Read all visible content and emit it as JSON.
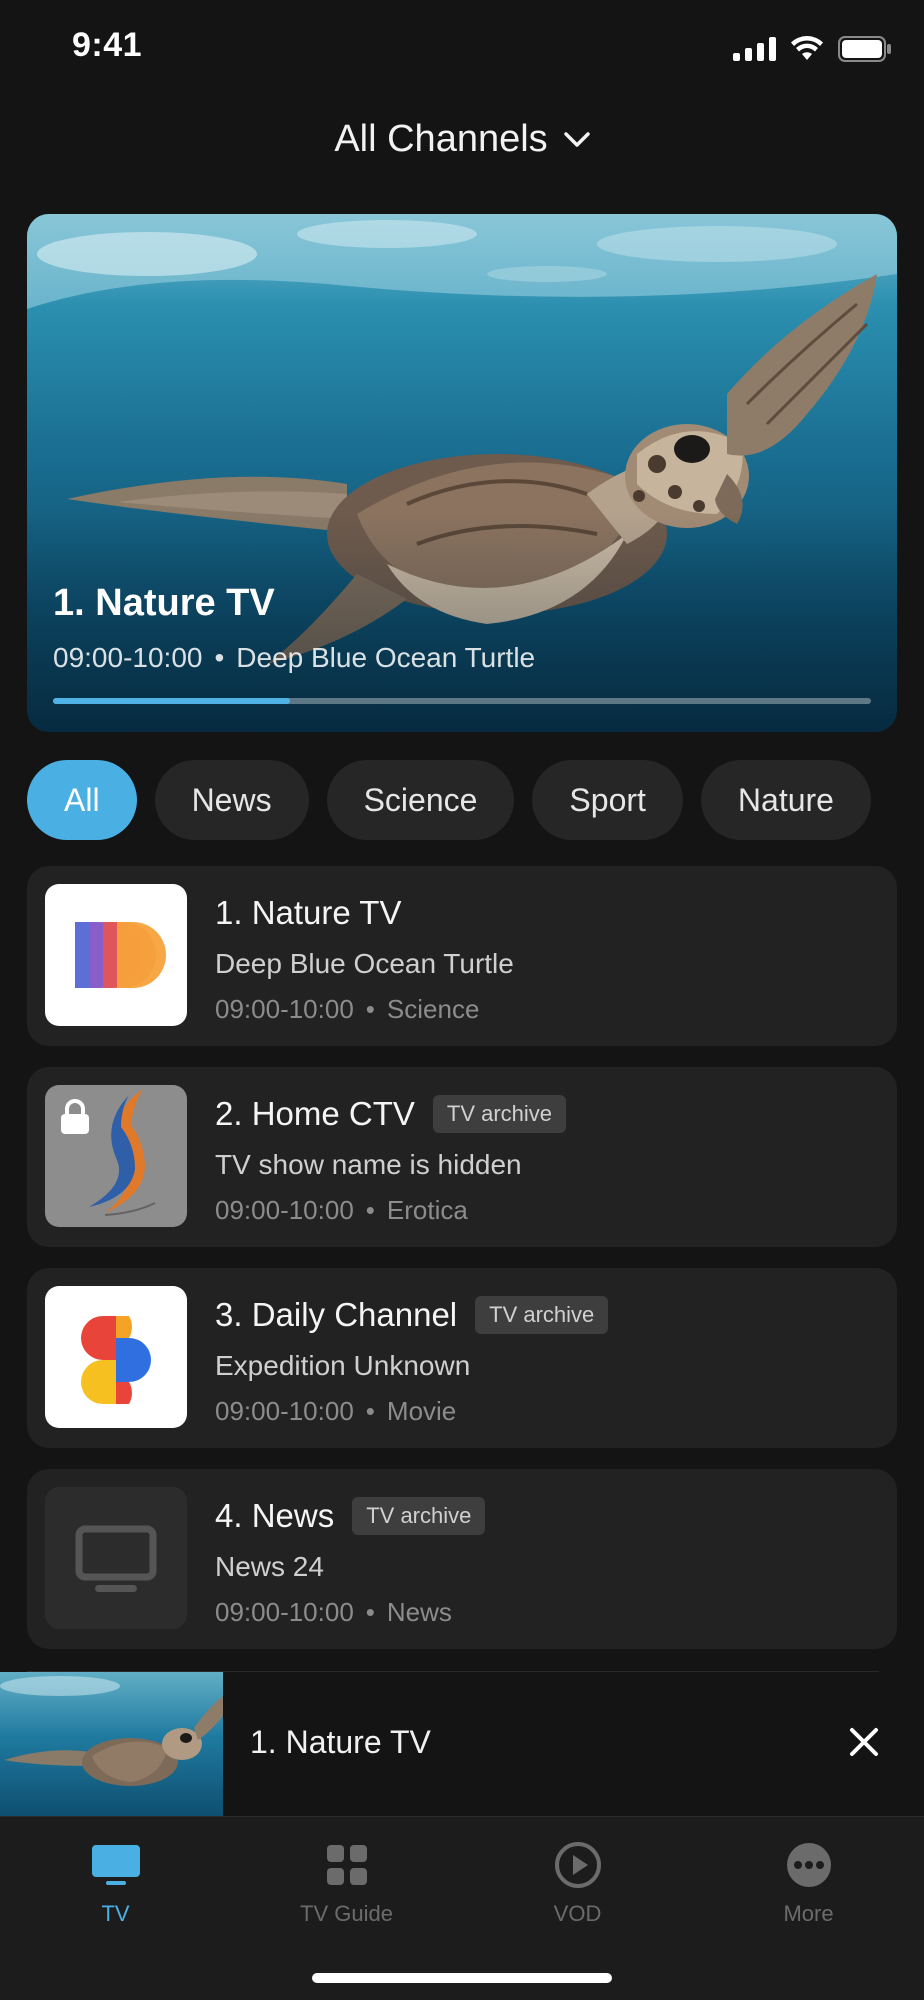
{
  "status_bar": {
    "time": "9:41"
  },
  "header": {
    "title": "All Channels"
  },
  "hero": {
    "title": "1. Nature TV",
    "time": "09:00-10:00",
    "separator": "•",
    "program": "Deep Blue Ocean Turtle",
    "progress": 0.29
  },
  "filters": [
    {
      "label": "All",
      "active": true
    },
    {
      "label": "News",
      "active": false
    },
    {
      "label": "Science",
      "active": false
    },
    {
      "label": "Sport",
      "active": false
    },
    {
      "label": "Nature",
      "active": false
    }
  ],
  "channels": [
    {
      "name": "1. Nature TV",
      "badge": "",
      "program": "Deep Blue Ocean Turtle",
      "time": "09:00-10:00",
      "separator": "•",
      "category": "Science",
      "logo": "nature-tv-logo"
    },
    {
      "name": "2. Home CTV",
      "badge": "TV archive",
      "program": "TV show name is hidden",
      "time": "09:00-10:00",
      "separator": "•",
      "category": "Erotica",
      "logo": "home-ctv-logo",
      "locked": true
    },
    {
      "name": "3. Daily Channel",
      "badge": "TV archive",
      "program": "Expedition Unknown",
      "time": "09:00-10:00",
      "separator": "•",
      "category": "Movie",
      "logo": "daily-channel-logo"
    },
    {
      "name": "4. News",
      "badge": "TV archive",
      "program": "News 24",
      "time": "09:00-10:00",
      "separator": "•",
      "category": "News",
      "logo": "tv-placeholder-icon"
    }
  ],
  "mini_player": {
    "title": "1. Nature TV"
  },
  "tabs": [
    {
      "label": "TV",
      "icon": "tv-icon",
      "active": true
    },
    {
      "label": "TV Guide",
      "icon": "grid-icon",
      "active": false
    },
    {
      "label": "VOD",
      "icon": "play-circle-icon",
      "active": false
    },
    {
      "label": "More",
      "icon": "more-icon",
      "active": false
    }
  ],
  "colors": {
    "accent": "#4ab0e4",
    "background": "#141414",
    "card": "#222222"
  }
}
